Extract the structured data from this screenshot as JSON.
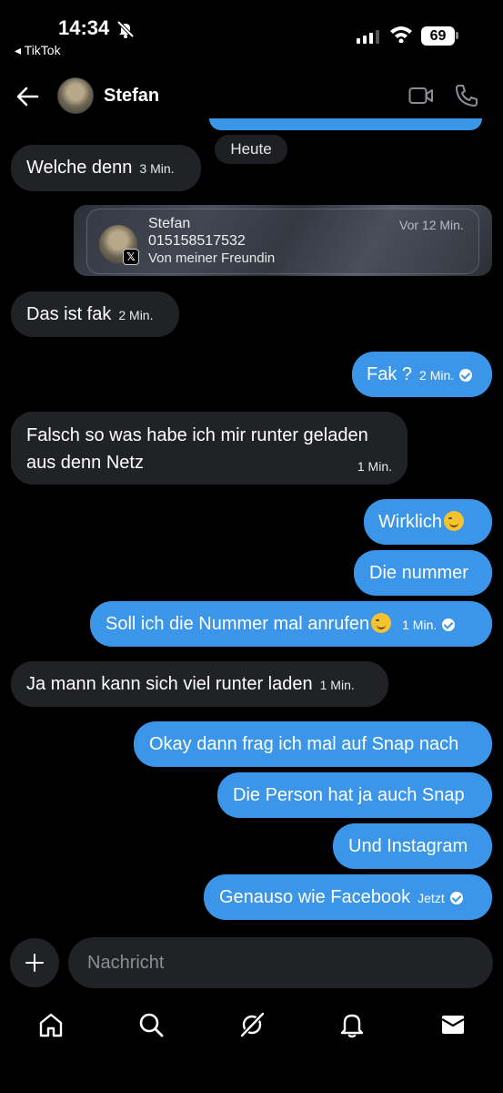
{
  "status_bar": {
    "time": "14:34",
    "back_app": "◂ TikTok",
    "battery": "69"
  },
  "header": {
    "contact_name": "Stefan"
  },
  "date_separator": "Heute",
  "shared_contact": {
    "name": "Stefan",
    "number": "015158517532",
    "note": "Von meiner Freundin",
    "time": "Vor 12 Min."
  },
  "messages": [
    {
      "dir": "in",
      "text": "Welche denn",
      "time": "3 Min."
    },
    {
      "dir": "in",
      "text": "Das ist fak",
      "time": "2 Min."
    },
    {
      "dir": "out",
      "text": "Fak ?",
      "time": "2 Min."
    },
    {
      "dir": "in",
      "text_line1": "Falsch so was habe ich mir runter geladen",
      "text_line2": "aus denn Netz",
      "time": "1 Min."
    },
    {
      "dir": "out",
      "text": "Wirklich"
    },
    {
      "dir": "out",
      "text": "Die nummer"
    },
    {
      "dir": "out",
      "text": "Soll ich die Nummer mal anrufen",
      "time": "1 Min."
    },
    {
      "dir": "in",
      "text": "Ja mann kann sich viel runter laden",
      "time": "1 Min."
    },
    {
      "dir": "out",
      "text": "Okay dann frag ich mal auf Snap nach"
    },
    {
      "dir": "out",
      "text": "Die Person hat ja auch Snap"
    },
    {
      "dir": "out",
      "text": "Und Instagram"
    },
    {
      "dir": "out",
      "text": "Genauso wie Facebook",
      "time": "Jetzt"
    }
  ],
  "composer": {
    "placeholder": "Nachricht"
  },
  "icons": {
    "nav": [
      "home-icon",
      "search-icon",
      "grok-icon",
      "notifications-icon",
      "messages-icon"
    ]
  },
  "colors": {
    "outgoing_bubble": "#3b96e9",
    "incoming_bubble": "#202225",
    "background": "#000000"
  }
}
